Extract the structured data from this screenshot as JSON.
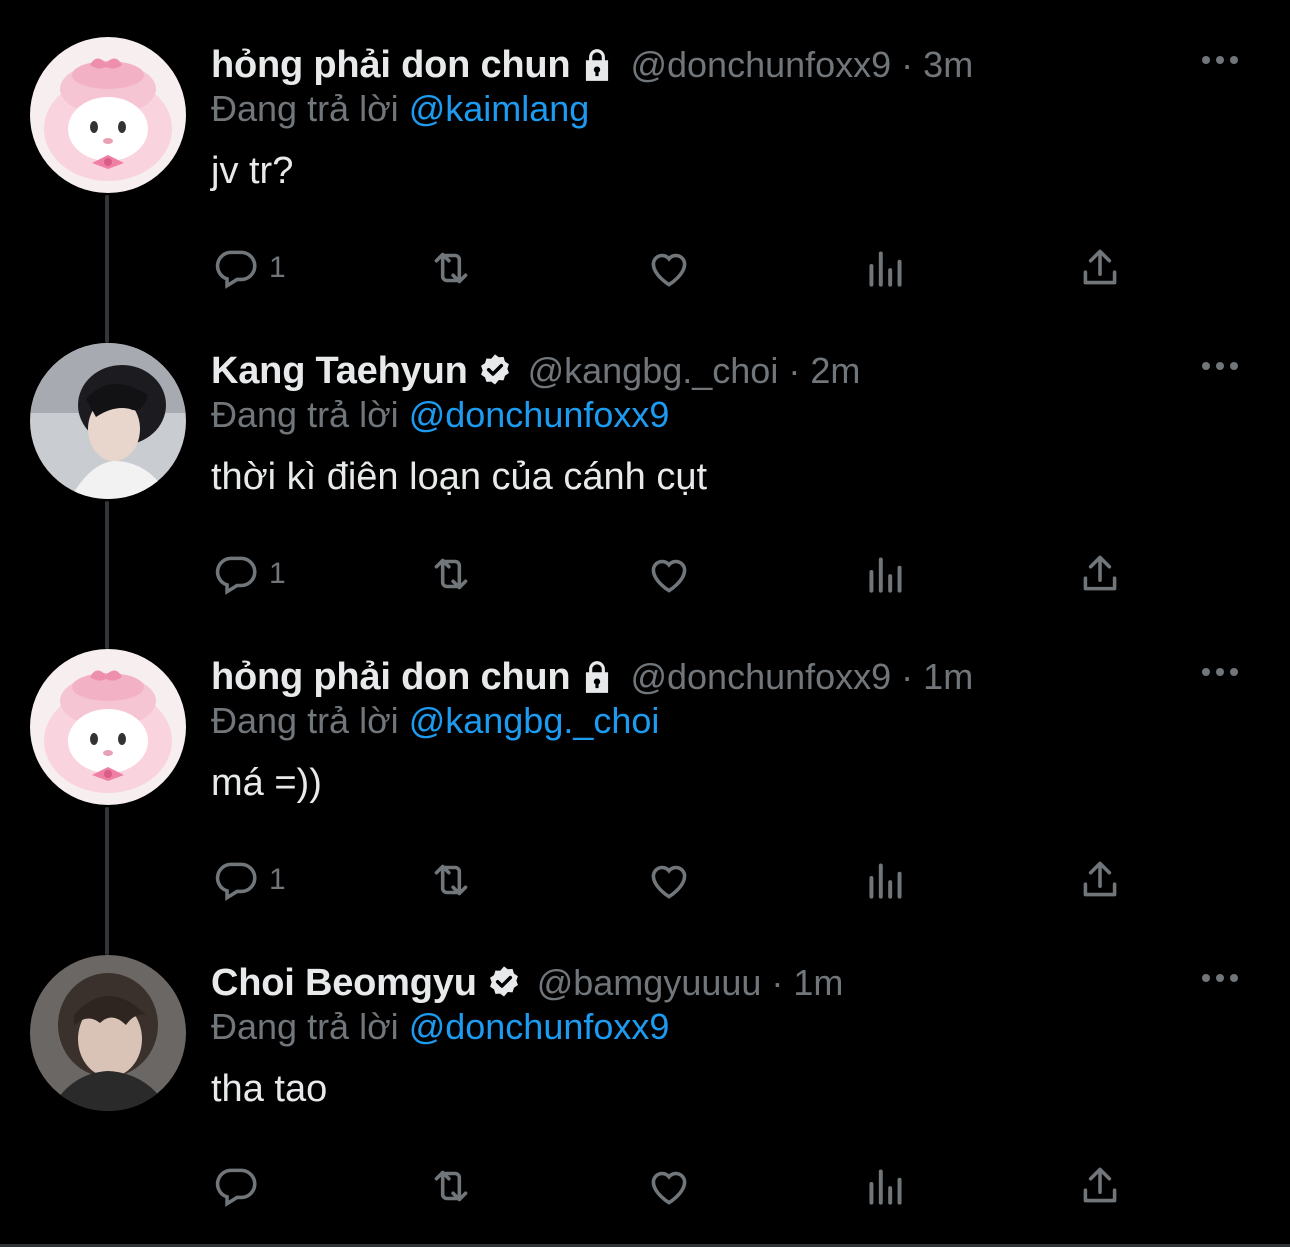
{
  "tweets": [
    {
      "display_name": "hỏng phải don chun",
      "badge": "lock-icon",
      "handle": "@donchunfoxx9",
      "separator": "·",
      "time": "3m",
      "reply_prefix": "Đang trả lời",
      "reply_to": "@kaimlang",
      "body": "jv tr?",
      "reply_count": "1",
      "avatar": "pink-bunny-avatar"
    },
    {
      "display_name": "Kang Taehyun",
      "badge": "verified-icon",
      "handle": "@kangbg._choi",
      "separator": "·",
      "time": "2m",
      "reply_prefix": "Đang trả lời",
      "reply_to": "@donchunfoxx9",
      "body": "thời kì điên loạn của cánh cụt",
      "reply_count": "1",
      "avatar": "photo-avatar"
    },
    {
      "display_name": "hỏng phải don chun",
      "badge": "lock-icon",
      "handle": "@donchunfoxx9",
      "separator": "·",
      "time": "1m",
      "reply_prefix": "Đang trả lời",
      "reply_to": "@kangbg._choi",
      "body": "má =))",
      "reply_count": "1",
      "avatar": "pink-bunny-avatar"
    },
    {
      "display_name": "Choi Beomgyu",
      "badge": "verified-icon",
      "handle": "@bamgyuuuu",
      "separator": "·",
      "time": "1m",
      "reply_prefix": "Đang trả lời",
      "reply_to": "@donchunfoxx9",
      "body": "tha tao",
      "reply_count": "",
      "avatar": "photo-avatar"
    }
  ],
  "colors": {
    "background": "#000000",
    "text": "#e7e9ea",
    "muted": "#71767b",
    "link": "#1d9bf0",
    "thread_line": "#333639"
  }
}
